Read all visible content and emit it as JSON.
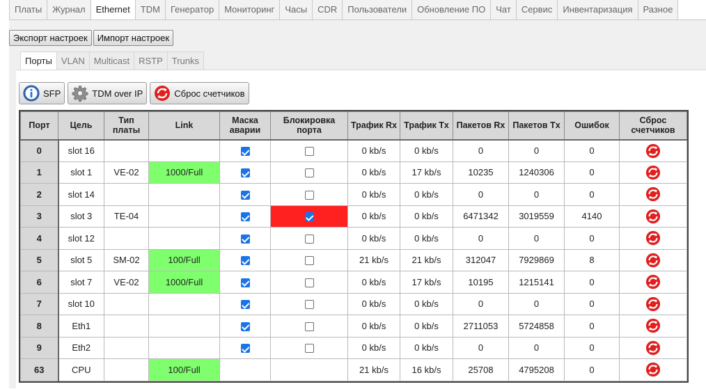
{
  "nav_tabs": [
    "Платы",
    "Журнал",
    "Ethernet",
    "TDM",
    "Генератор",
    "Мониторинг",
    "Часы",
    "CDR",
    "Пользователи",
    "Обновление ПО",
    "Чат",
    "Сервис",
    "Инвентаризация",
    "Разное"
  ],
  "nav_active": "Ethernet",
  "settings_buttons": {
    "export": "Экспорт настроек",
    "import": "Импорт настроек"
  },
  "sub_tabs": [
    "Порты",
    "VLAN",
    "Multicast",
    "RSTP",
    "Trunks"
  ],
  "sub_active": "Порты",
  "toolbar": {
    "sfp": "SFP",
    "tdm": "TDM over IP",
    "reset": "Сброс счетчиков"
  },
  "columns": {
    "port": "Порт",
    "target": "Цель",
    "board_type": "Тип платы",
    "link": "Link",
    "alarm_mask": "Маска аварии",
    "port_block": "Блокировка порта",
    "traffic_rx": "Трафик Rx",
    "traffic_tx": "Трафик Tx",
    "packets_rx": "Пакетов Rx",
    "packets_tx": "Пакетов Tx",
    "errors": "Ошибок",
    "reset": "Сброс счетчиков"
  },
  "rows": [
    {
      "port": "0",
      "target": "slot 16",
      "board": "",
      "link": "",
      "mask": true,
      "block": false,
      "rx": "0 kb/s",
      "tx": "0 kb/s",
      "prx": "0",
      "ptx": "0",
      "err": "0"
    },
    {
      "port": "1",
      "target": "slot 1",
      "board": "VE-02",
      "link": "1000/Full",
      "mask": true,
      "block": false,
      "rx": "0 kb/s",
      "tx": "17 kb/s",
      "prx": "10235",
      "ptx": "1240306",
      "err": "0"
    },
    {
      "port": "2",
      "target": "slot 14",
      "board": "",
      "link": "",
      "mask": true,
      "block": false,
      "rx": "0 kb/s",
      "tx": "0 kb/s",
      "prx": "0",
      "ptx": "0",
      "err": "0"
    },
    {
      "port": "3",
      "target": "slot 3",
      "board": "TE-04",
      "link": "",
      "mask": true,
      "block": true,
      "rx": "0 kb/s",
      "tx": "0 kb/s",
      "prx": "6471342",
      "ptx": "3019559",
      "err": "4140"
    },
    {
      "port": "4",
      "target": "slot 12",
      "board": "",
      "link": "",
      "mask": true,
      "block": false,
      "rx": "0 kb/s",
      "tx": "0 kb/s",
      "prx": "0",
      "ptx": "0",
      "err": "0"
    },
    {
      "port": "5",
      "target": "slot 5",
      "board": "SM-02",
      "link": "100/Full",
      "mask": true,
      "block": false,
      "rx": "21 kb/s",
      "tx": "21 kb/s",
      "prx": "312047",
      "ptx": "7929869",
      "err": "8"
    },
    {
      "port": "6",
      "target": "slot 7",
      "board": "VE-02",
      "link": "1000/Full",
      "mask": true,
      "block": false,
      "rx": "0 kb/s",
      "tx": "17 kb/s",
      "prx": "10195",
      "ptx": "1215141",
      "err": "0"
    },
    {
      "port": "7",
      "target": "slot 10",
      "board": "",
      "link": "",
      "mask": true,
      "block": false,
      "rx": "0 kb/s",
      "tx": "0 kb/s",
      "prx": "0",
      "ptx": "0",
      "err": "0"
    },
    {
      "port": "8",
      "target": "Eth1",
      "board": "",
      "link": "",
      "mask": true,
      "block": false,
      "rx": "0 kb/s",
      "tx": "0 kb/s",
      "prx": "2711053",
      "ptx": "5724858",
      "err": "0"
    },
    {
      "port": "9",
      "target": "Eth2",
      "board": "",
      "link": "",
      "mask": true,
      "block": false,
      "rx": "0 kb/s",
      "tx": "0 kb/s",
      "prx": "0",
      "ptx": "0",
      "err": "0"
    },
    {
      "port": "63",
      "target": "CPU",
      "board": "",
      "link": "100/Full",
      "mask": null,
      "block": null,
      "rx": "21 kb/s",
      "tx": "16 kb/s",
      "prx": "25708",
      "ptx": "4795208",
      "err": "0"
    }
  ],
  "colors": {
    "link_up": "#80ff6e",
    "port_blocked": "#ff2020",
    "checkbox_on": "#1a73e8",
    "reset_icon": "#e02020"
  }
}
